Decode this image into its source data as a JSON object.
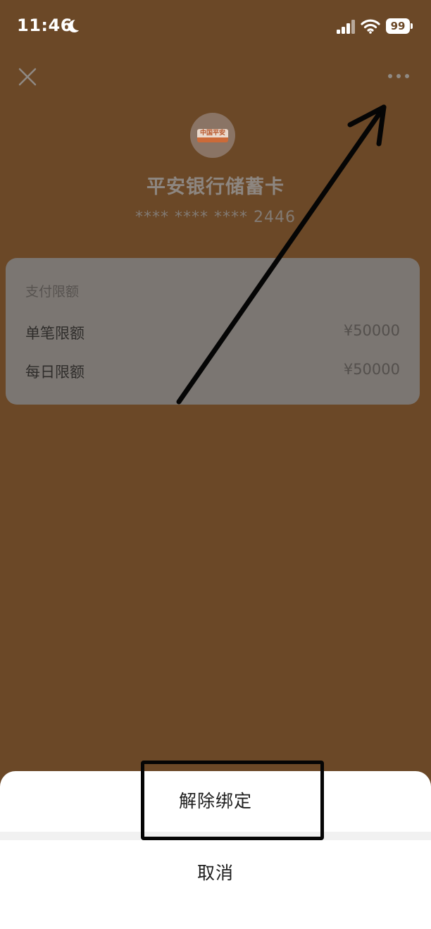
{
  "status_bar": {
    "time": "11:46",
    "battery": "99"
  },
  "icons": {
    "close": "close-icon",
    "more": "more-icon",
    "moon": "moon-icon",
    "signal": "signal-icon",
    "wifi": "wifi-icon"
  },
  "bank": {
    "logo_text": "中国平安",
    "name": "平安银行储蓄卡",
    "card_number": "**** **** **** 2446"
  },
  "limits": {
    "title": "支付限额",
    "rows": [
      {
        "label": "单笔限额",
        "value": "¥50000"
      },
      {
        "label": "每日限额",
        "value": "¥50000"
      }
    ]
  },
  "action_sheet": {
    "unbind_label": "解除绑定",
    "cancel_label": "取消"
  },
  "colors": {
    "overlay_background": "#6b4827",
    "sheet_background": "#ffffff",
    "annotation": "#050505"
  }
}
